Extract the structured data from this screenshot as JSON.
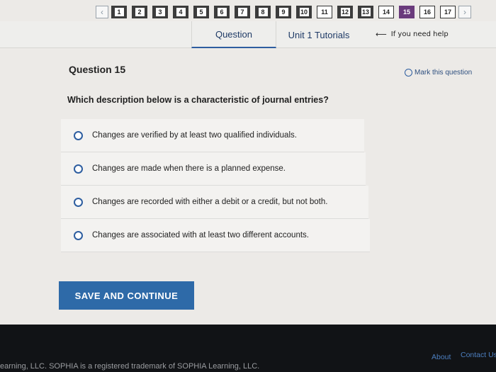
{
  "nav": {
    "prev_icon": "chevron-left-icon",
    "next_icon": "chevron-right-icon",
    "questions": [
      {
        "n": "1",
        "state": "done"
      },
      {
        "n": "2",
        "state": "done"
      },
      {
        "n": "3",
        "state": "done"
      },
      {
        "n": "4",
        "state": "done"
      },
      {
        "n": "5",
        "state": "done"
      },
      {
        "n": "6",
        "state": "done"
      },
      {
        "n": "7",
        "state": "done"
      },
      {
        "n": "8",
        "state": "done"
      },
      {
        "n": "9",
        "state": "done"
      },
      {
        "n": "10",
        "state": "done"
      },
      {
        "n": "11",
        "state": "open"
      },
      {
        "n": "12",
        "state": "done"
      },
      {
        "n": "13",
        "state": "done"
      },
      {
        "n": "14",
        "state": "open"
      },
      {
        "n": "15",
        "state": "current"
      },
      {
        "n": "16",
        "state": "open"
      },
      {
        "n": "17",
        "state": "open"
      }
    ]
  },
  "tabs": {
    "question": "Question",
    "tutorials": "Unit 1 Tutorials"
  },
  "help_note": "If you need help",
  "question": {
    "title": "Question 15",
    "mark_label": "Mark this question",
    "prompt": "Which description below is a characteristic of journal entries?",
    "options": [
      "Changes are verified by at least two qualified individuals.",
      "Changes are made when there is a planned expense.",
      "Changes are recorded with either a debit or a credit, but not both.",
      "Changes are associated with at least two different accounts."
    ]
  },
  "save_label": "SAVE AND CONTINUE",
  "footer": {
    "copyright": "earning, LLC. SOPHIA is a registered trademark of SOPHIA Learning, LLC.",
    "about": "About",
    "contact": "Contact Us"
  },
  "colors": {
    "accent": "#2e6aa8",
    "current_question": "#6a3b7c",
    "footer_bg": "#111316"
  }
}
